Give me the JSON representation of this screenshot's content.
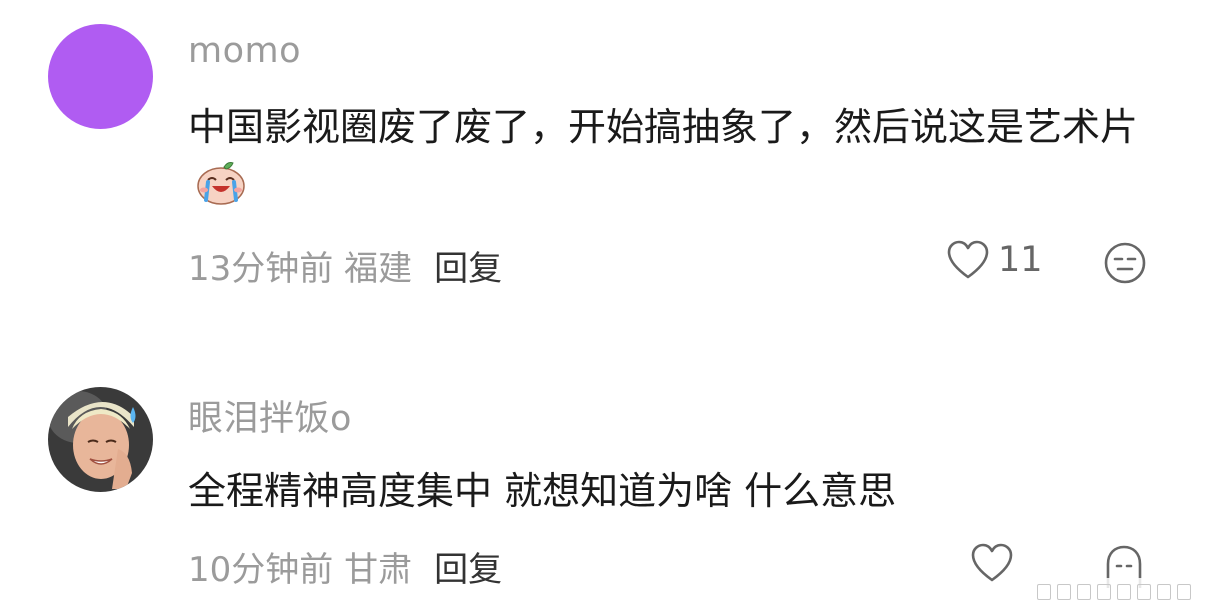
{
  "comments": [
    {
      "username": "momo",
      "text": "中国影视圈废了废了，开始搞抽象了，然后说这是艺术片",
      "emoji_icon": "crying-laughing-sticker-icon",
      "time": "13分钟前",
      "location": "福建",
      "reply_label": "回复",
      "likes": "11",
      "avatar_color": "#b05cf2"
    },
    {
      "username": "眼泪拌饭o",
      "text": "全程精神高度集中 就想知道为啥 什么意思",
      "time": "10分钟前",
      "location": "甘肃",
      "reply_label": "回复",
      "avatar_icon": "profile-photo-avatar"
    }
  ],
  "colors": {
    "username": "#9b9b9b",
    "meta": "#9b9b9b",
    "reply": "#333333",
    "text": "#1a1a1a"
  }
}
